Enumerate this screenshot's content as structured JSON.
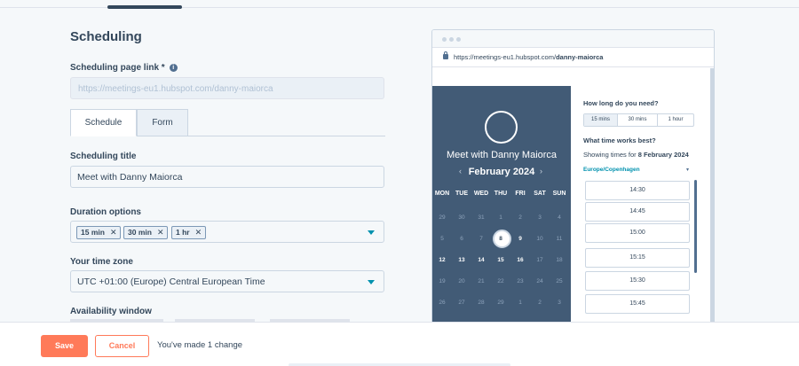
{
  "form": {
    "heading": "Scheduling",
    "link_label": "Scheduling page link *",
    "link_placeholder": "https://meetings-eu1.hubspot.com/danny-maiorca",
    "tabs": [
      {
        "label": "Schedule"
      },
      {
        "label": "Form"
      }
    ],
    "title_label": "Scheduling title",
    "title_value": "Meet with Danny Maiorca",
    "duration_label": "Duration options",
    "duration_chips": [
      "15 min",
      "30 min",
      "1 hr"
    ],
    "timezone_label": "Your time zone",
    "timezone_value": "UTC +01:00 (Europe) Central European Time",
    "availability_label": "Availability window"
  },
  "footer": {
    "save_label": "Save",
    "cancel_label": "Cancel",
    "change_message": "You've made 1 change"
  },
  "preview": {
    "url_prefix": "https://meetings-eu1.hubspot.com/",
    "url_bold": "danny-maiorca",
    "calendar": {
      "meeting_title": "Meet with Danny Maiorca",
      "month": "February 2024",
      "prev_arrow": "‹",
      "next_arrow": "›",
      "day_headers": [
        "MON",
        "TUE",
        "WED",
        "THU",
        "FRI",
        "SAT",
        "SUN"
      ],
      "weeks": [
        [
          "29",
          "30",
          "31",
          "1",
          "2",
          "3",
          "4"
        ],
        [
          "5",
          "6",
          "7",
          "8",
          "9",
          "10",
          "11"
        ],
        [
          "12",
          "13",
          "14",
          "15",
          "16",
          "17",
          "18"
        ],
        [
          "19",
          "20",
          "21",
          "22",
          "23",
          "24",
          "25"
        ],
        [
          "26",
          "27",
          "28",
          "29",
          "1",
          "2",
          "3"
        ]
      ],
      "selected_day": "8",
      "available_days": [
        "9",
        "12",
        "13",
        "14",
        "15",
        "16"
      ]
    },
    "side": {
      "duration_question": "How long do you need?",
      "durations": [
        "15 mins",
        "30 mins",
        "1 hour"
      ],
      "time_question": "What time works best?",
      "showing_prefix": "Showing times for ",
      "showing_date": "8 February 2024",
      "timezone": "Europe/Copenhagen",
      "slots": [
        "14:30",
        "14:45",
        "15:00",
        "15:15",
        "15:30",
        "15:45"
      ]
    }
  },
  "colors": {
    "accent": "#ff7a59",
    "calendar_bg": "#425b76",
    "link": "#0091ae"
  }
}
